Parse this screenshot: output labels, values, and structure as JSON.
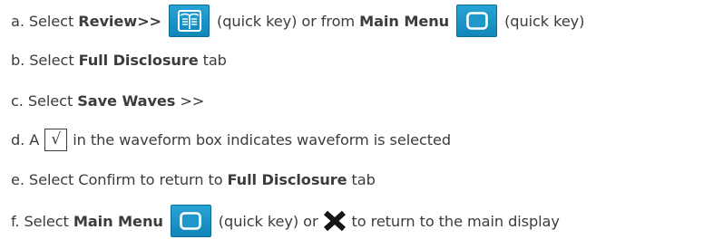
{
  "steps": [
    {
      "marker": "a.",
      "t1": "Select",
      "b1": "Review>>",
      "t2": "(quick key) or from",
      "b2": "Main Menu",
      "t3": "(quick key)",
      "icons": [
        "review-key-icon",
        "main-menu-key-icon"
      ]
    },
    {
      "marker": "b.",
      "t1": "Select",
      "b1": "Full Disclosure",
      "t2": "tab"
    },
    {
      "marker": "c.",
      "t1": "Select",
      "b1": "Save Waves",
      "t2": ">>"
    },
    {
      "marker": "d.",
      "t1": "A",
      "check": "√",
      "t2": "in the waveform box indicates waveform is selected"
    },
    {
      "marker": "e.",
      "t1": "Select Confirm to return to",
      "b1": "Full Disclosure",
      "t2": "tab"
    },
    {
      "marker": "f.",
      "t1": "Select",
      "b1": "Main Menu",
      "t2": "(quick key) or",
      "t3": "to return to the main display",
      "icons": [
        "main-menu-key-icon",
        "close-x-icon"
      ]
    }
  ],
  "colors": {
    "text": "#3c3c3c",
    "key_fill": "#1f97c9",
    "key_border": "#0a6e98",
    "key_glyph": "#ffffff",
    "x_icon": "#141414"
  }
}
